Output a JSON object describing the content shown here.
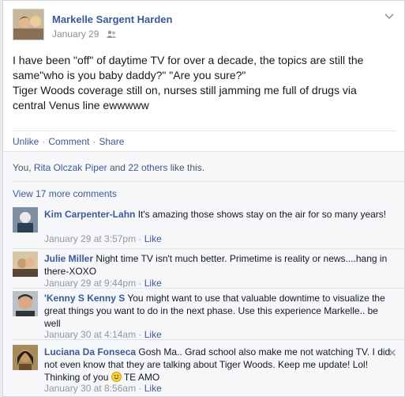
{
  "post": {
    "author": "Markelle Sargent Harden",
    "date": "January 29",
    "body": "I have been \"off\" of daytime TV for over a decade, the topics are still the same\"who is you baby daddy?\" \"Are you sure?\"\nTiger Woods coverage still on, nurses still jamming me full of drugs via central Venus line ewwwww",
    "audience_icon": "friends-icon",
    "menu_icon": "chevron-down-icon"
  },
  "actions": {
    "unlike": "Unlike",
    "comment": "Comment",
    "share": "Share",
    "separator": "·"
  },
  "likes": {
    "prefix": "You, ",
    "name": "Rita Olczak Piper",
    "middle": " and ",
    "others": "22 others",
    "suffix": " like this."
  },
  "view_more": "View 17 more comments",
  "comments": [
    {
      "name": "Kim Carpenter-Lahn",
      "text": " It's amazing those shows stay on the air for so many years!",
      "time": "January 29 at 3:57pm",
      "like": "Like"
    },
    {
      "name": "Julie Miller",
      "text": " Night time TV isn't much better. Primetime is reality or news....hang in there-XOXO",
      "time": "January 29 at 9:44pm",
      "like": "Like"
    },
    {
      "name": "'Kenny S Kenny S",
      "text": " You might want to use that valuable downtime to visualize the great things you want to do in the next phase. Use this experience Markelle.. be well",
      "time": "January 30 at 4:14am",
      "like": "Like"
    },
    {
      "name": "Luciana Da Fonseca",
      "text": " Gosh Ma.. Grad school also make me not watching TV. I did not even know that they are talking about Tiger Woods. Keep me update! Lol! Thinking of you ",
      "text_after": " TE AMO",
      "time": "January 30 at 8:56am",
      "like": "Like",
      "emoticon": "smile-emoticon",
      "remove_icon": "close-icon"
    }
  ],
  "meta_separator": " · "
}
